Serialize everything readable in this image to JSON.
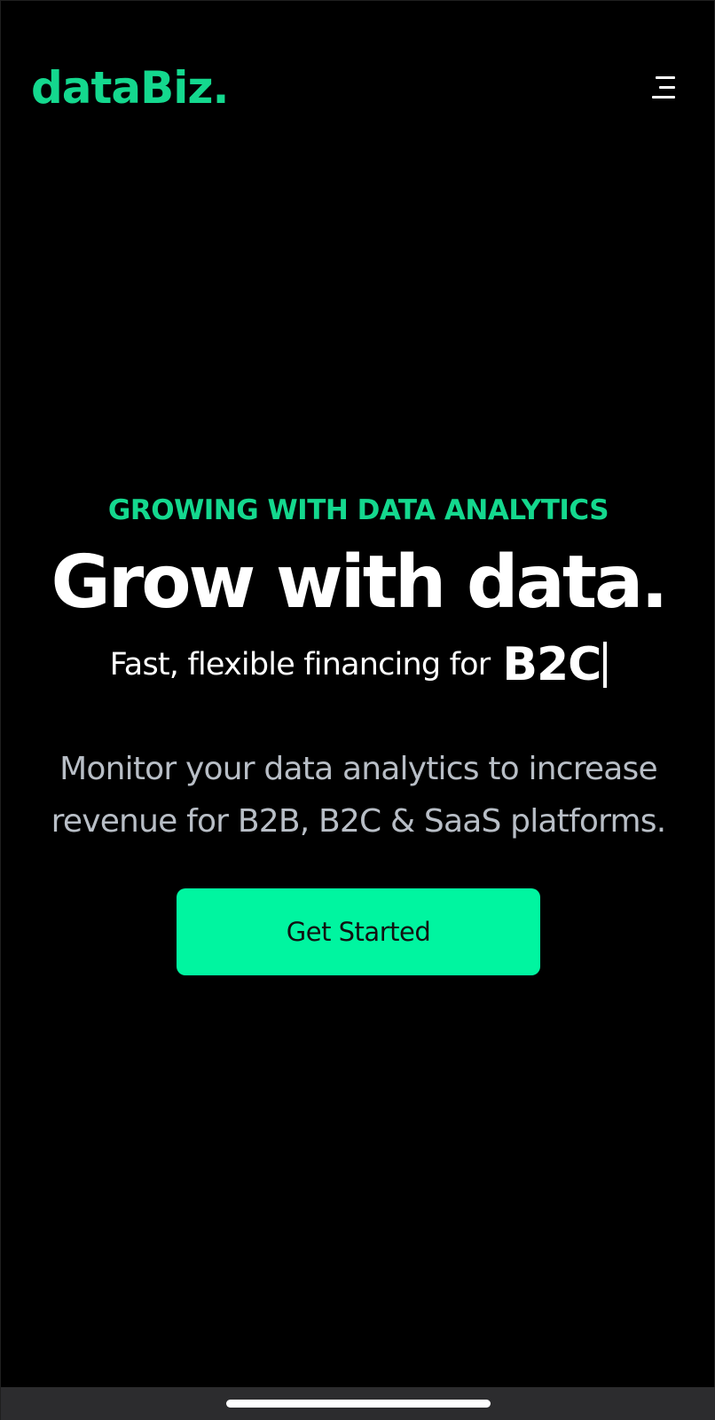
{
  "header": {
    "logo": "dataBiz.",
    "menu_icon": "hamburger-menu-icon"
  },
  "hero": {
    "eyebrow": "GROWING WITH DATA ANALYTICS",
    "headline": "Grow with data.",
    "subhead_lead": "Fast, flexible financing for",
    "subhead_typed": "B2C",
    "description": "Monitor your data analytics to increase revenue for B2B, B2C & SaaS platforms.",
    "cta_label": "Get Started"
  },
  "colors": {
    "background": "#000000",
    "brand_green": "#14d88e",
    "button_green": "#00f5a0",
    "description_text": "#b8bec6",
    "system_bar": "#2c2c2e"
  }
}
